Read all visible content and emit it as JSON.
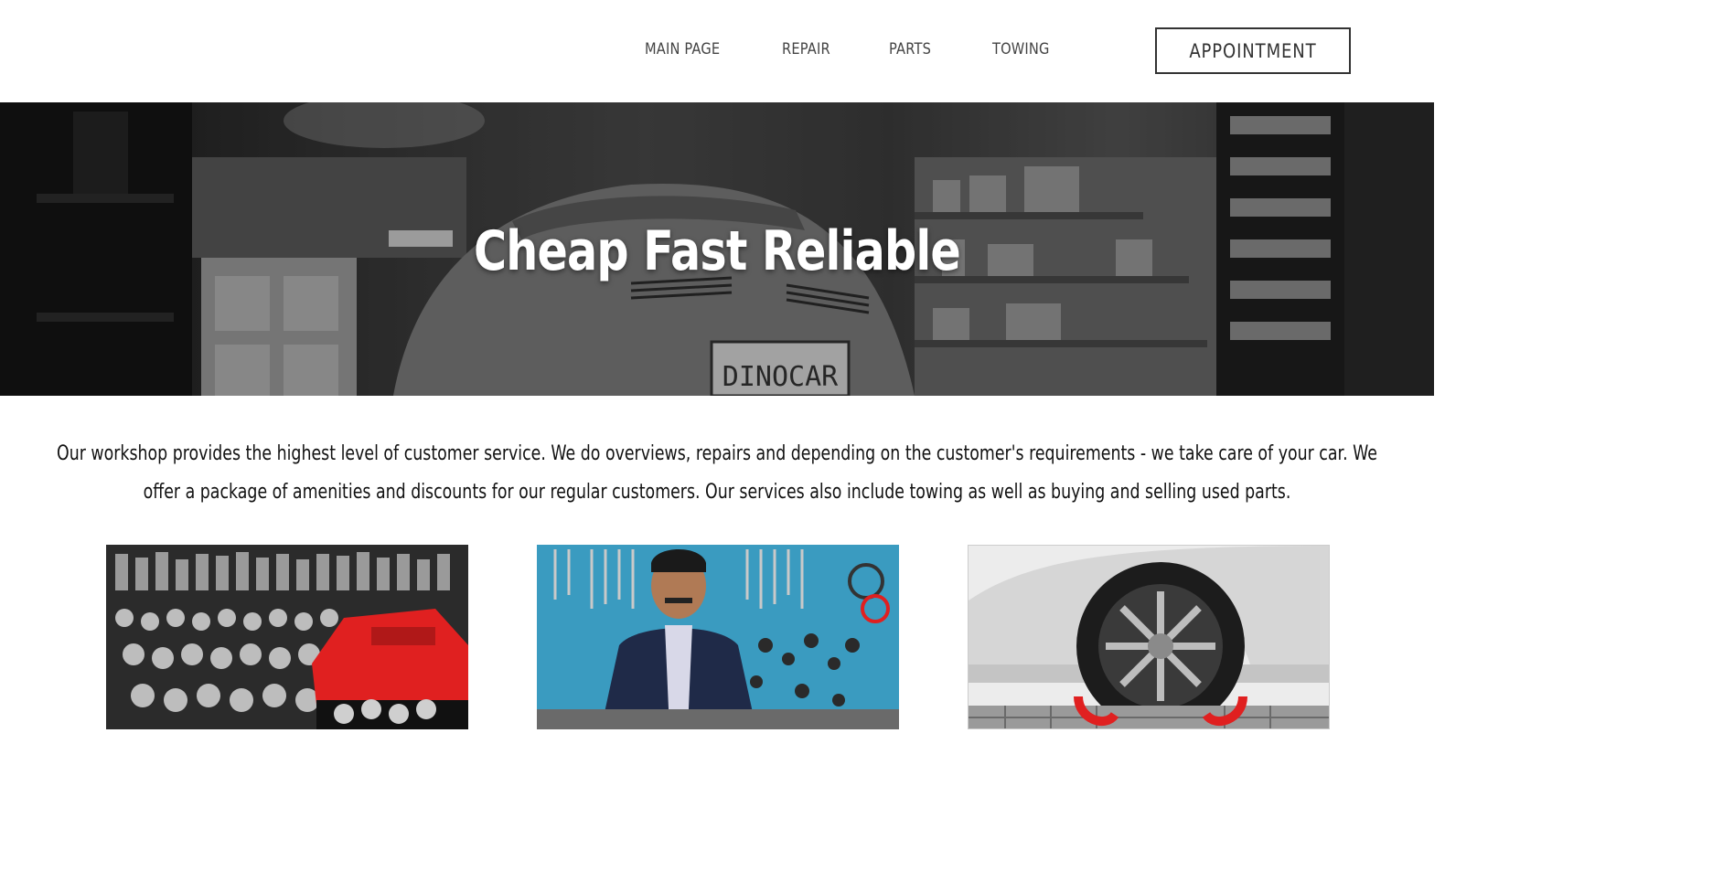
{
  "nav": {
    "items": [
      {
        "label": "MAIN PAGE"
      },
      {
        "label": "REPAIR"
      },
      {
        "label": "PARTS"
      },
      {
        "label": "TOWING"
      }
    ],
    "appointment_label": "APPOINTMENT"
  },
  "hero": {
    "title": "Cheap Fast Reliable",
    "plate_text": "DINOCAR"
  },
  "intro": {
    "text": "Our workshop provides the highest level of customer service. We do overviews, repairs and depending on the customer's requirements - we take care of your car. We offer a package of amenities and discounts for our regular customers. Our services also include towing as well as buying and selling used parts."
  },
  "colors": {
    "nav_text": "#444444",
    "button_border": "#333333",
    "hero_overlay": "#2a2a2a",
    "accent_red": "#e02020",
    "wall_blue": "#3a9bc0"
  }
}
